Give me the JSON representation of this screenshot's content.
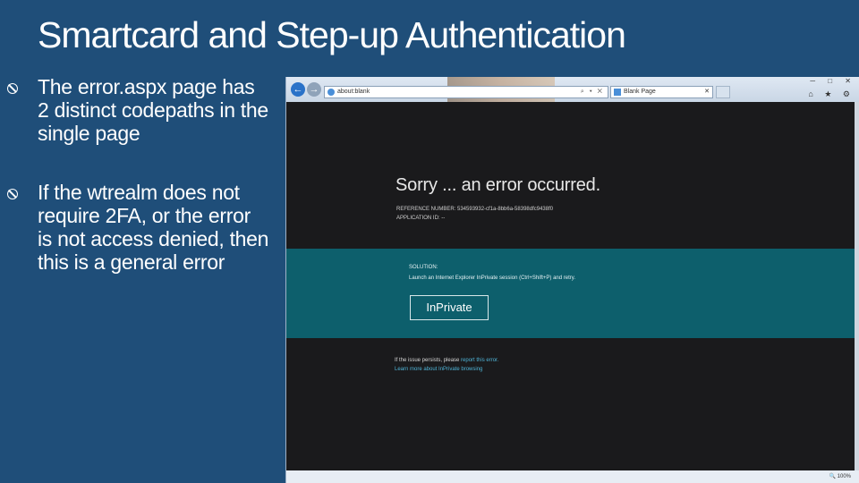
{
  "slide": {
    "title": "Smartcard and Step-up Authentication",
    "bullets": [
      {
        "text": "The error.aspx page has 2 distinct codepaths in the single page"
      },
      {
        "text": "If the wtrealm does not require 2FA, or the error is not access denied, then this is a general error"
      }
    ]
  },
  "browser": {
    "address": "about:blank",
    "address_tools": "⌕ ▾ ✕",
    "tab_label": "Blank Page",
    "tab_close": "✕",
    "window_controls": "─ □ ✕",
    "tool_icons": "⌂ ★ ⚙",
    "error_title": "Sorry ... an error occurred.",
    "reference": "REFERENCE NUMBER: 534593932-cf1a-8bb6a-58398dfc9438f0",
    "application": "APPLICATION ID: --",
    "solution_label": "SOLUTION:",
    "solution_text": "Launch an Internet Explorer InPrivate session (Ctrl+Shift+P) and retry.",
    "inprivate_button": "InPrivate",
    "footer_prefix": "If the issue persists, please",
    "footer_link": "report this error.",
    "footer_learn": "Learn more about InPrivate browsing",
    "zoom": "🔍 100%"
  },
  "colors": {
    "slide_background": "#1f4e79",
    "page_background": "#1a1a1c",
    "solution_band": "#0d5f6c",
    "link": "#4fb3d6"
  }
}
